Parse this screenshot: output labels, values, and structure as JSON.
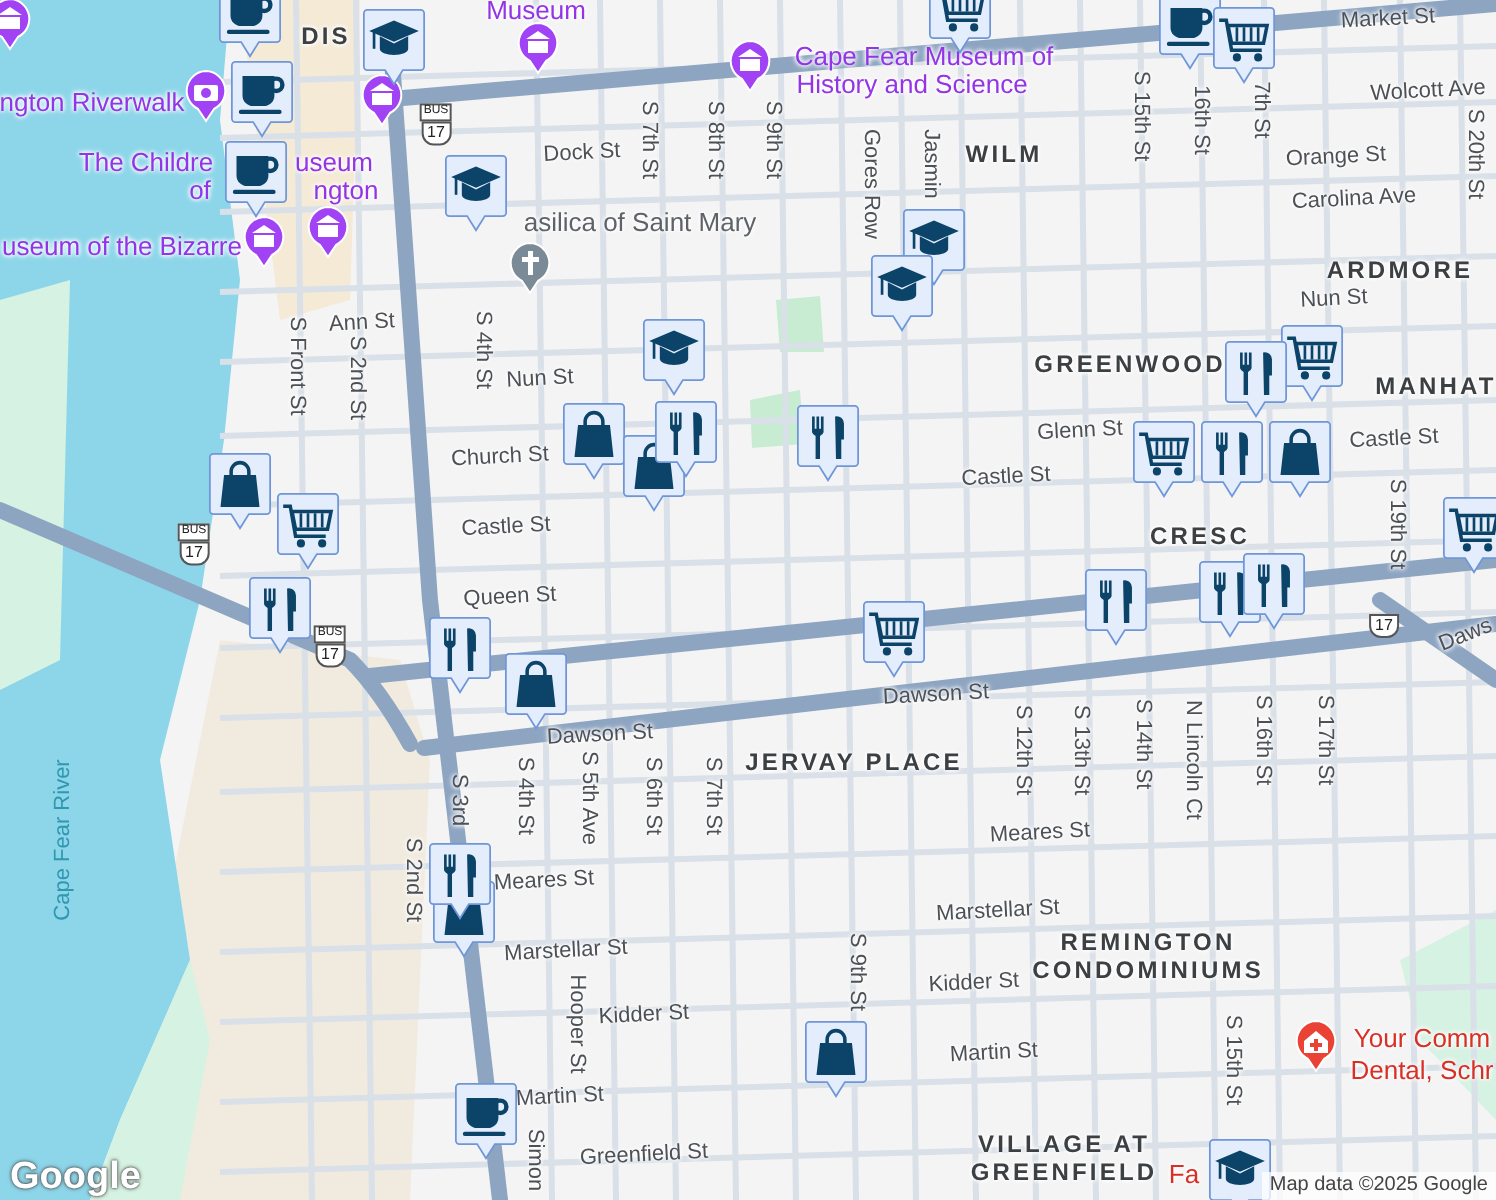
{
  "map": {
    "labels": [
      {
        "kind": "street",
        "text": "Dock St"
      },
      {
        "kind": "street",
        "text": "Ann St"
      },
      {
        "kind": "street",
        "text": "Nun St"
      },
      {
        "kind": "street",
        "text": "Church St"
      },
      {
        "kind": "street",
        "text": "Castle St"
      },
      {
        "kind": "street",
        "text": "Queen St"
      },
      {
        "kind": "street",
        "text": "Dawson St"
      },
      {
        "kind": "street",
        "text": "Dawson St"
      },
      {
        "kind": "street",
        "text": "Meares St"
      },
      {
        "kind": "street",
        "text": "Meares St"
      },
      {
        "kind": "street",
        "text": "Marstellar St"
      },
      {
        "kind": "street",
        "text": "Marstellar St"
      },
      {
        "kind": "street",
        "text": "Kidder St"
      },
      {
        "kind": "street",
        "text": "Kidder St"
      },
      {
        "kind": "street",
        "text": "Martin St"
      },
      {
        "kind": "street",
        "text": "Martin St"
      },
      {
        "kind": "street",
        "text": "Greenfield St"
      },
      {
        "kind": "street",
        "text": "Orange St"
      },
      {
        "kind": "street",
        "text": "Carolina Ave"
      },
      {
        "kind": "street",
        "text": "Wolcott Ave"
      },
      {
        "kind": "street",
        "text": "Nun St"
      },
      {
        "kind": "street",
        "text": "Glenn St"
      },
      {
        "kind": "street",
        "text": "Castle St"
      },
      {
        "kind": "street",
        "text": "Castle St"
      },
      {
        "kind": "street",
        "text": "Market St"
      },
      {
        "kind": "street",
        "text": "Daws"
      },
      {
        "kind": "street",
        "text": "S Front St"
      },
      {
        "kind": "street",
        "text": "S 2nd St"
      },
      {
        "kind": "street",
        "text": "S 4th St"
      },
      {
        "kind": "street",
        "text": "S 7th St"
      },
      {
        "kind": "street",
        "text": "S 8th St"
      },
      {
        "kind": "street",
        "text": "S 9th St"
      },
      {
        "kind": "street",
        "text": "Gores Row"
      },
      {
        "kind": "street",
        "text": "Jasmin"
      },
      {
        "kind": "street",
        "text": "S 15th St"
      },
      {
        "kind": "street",
        "text": "16th St"
      },
      {
        "kind": "street",
        "text": "7th St"
      },
      {
        "kind": "street",
        "text": "S 20th St"
      },
      {
        "kind": "street",
        "text": "S 3rd"
      },
      {
        "kind": "street",
        "text": "S 4th St"
      },
      {
        "kind": "street",
        "text": "S 5th Ave"
      },
      {
        "kind": "street",
        "text": "S 6th St"
      },
      {
        "kind": "street",
        "text": "S 7th St"
      },
      {
        "kind": "street",
        "text": "S 2nd St"
      },
      {
        "kind": "street",
        "text": "Hooper St"
      },
      {
        "kind": "street",
        "text": "Simon"
      },
      {
        "kind": "street",
        "text": "S 12th St"
      },
      {
        "kind": "street",
        "text": "S 13th St"
      },
      {
        "kind": "street",
        "text": "S 14th St"
      },
      {
        "kind": "street",
        "text": "N Lincoln Ct"
      },
      {
        "kind": "street",
        "text": "S 16th St"
      },
      {
        "kind": "street",
        "text": "S 17th St"
      },
      {
        "kind": "street",
        "text": "S 9th St"
      },
      {
        "kind": "street",
        "text": "S 15th St"
      },
      {
        "kind": "street",
        "text": "S 19th St"
      },
      {
        "kind": "area",
        "text": "DIS"
      },
      {
        "kind": "area",
        "text": "WILM"
      },
      {
        "kind": "area",
        "text": "ARDMORE"
      },
      {
        "kind": "area",
        "text": "GREENWOOD"
      },
      {
        "kind": "area",
        "text": "MANHAT"
      },
      {
        "kind": "area",
        "text": "CRESC"
      },
      {
        "kind": "area",
        "text": "JERVAY PLACE"
      },
      {
        "kind": "area",
        "text": "REMINGTON"
      },
      {
        "kind": "area",
        "text": "CONDOMINIUMS"
      },
      {
        "kind": "area",
        "text": "VILLAGE AT"
      },
      {
        "kind": "area",
        "text": "GREENFIELD"
      },
      {
        "kind": "attraction",
        "text": "Museum"
      },
      {
        "kind": "attraction",
        "text": "Cape Fear Museum of"
      },
      {
        "kind": "attraction",
        "text": "History and Science"
      },
      {
        "kind": "attraction",
        "text": "ngton Riverwalk"
      },
      {
        "kind": "attraction",
        "text": "The Childre"
      },
      {
        "kind": "attraction",
        "text": "useum"
      },
      {
        "kind": "attraction",
        "text": "of"
      },
      {
        "kind": "attraction",
        "text": "ngton"
      },
      {
        "kind": "attraction",
        "text": "useum of the Bizarre"
      },
      {
        "kind": "worship",
        "text": "asilica of Saint Mary"
      },
      {
        "kind": "water",
        "text": "Cape Fear River"
      },
      {
        "kind": "health",
        "text": "Your Comm"
      },
      {
        "kind": "health",
        "text": "Dental, Schr"
      },
      {
        "kind": "health",
        "text": "Fa"
      }
    ],
    "shields": [
      {
        "top": "BUS",
        "number": "17"
      },
      {
        "top": "BUS",
        "number": "17"
      },
      {
        "top": "BUS",
        "number": "17"
      },
      {
        "number": "17"
      }
    ],
    "places": [
      {
        "kind": "museum"
      },
      {
        "kind": "museum"
      },
      {
        "kind": "museum"
      },
      {
        "kind": "museum"
      },
      {
        "kind": "museum"
      },
      {
        "kind": "museum"
      },
      {
        "kind": "camera"
      },
      {
        "kind": "church"
      },
      {
        "kind": "dental"
      }
    ],
    "pins": [
      {
        "kind": "cup"
      },
      {
        "kind": "cup"
      },
      {
        "kind": "cup"
      },
      {
        "kind": "cup"
      },
      {
        "kind": "cup"
      },
      {
        "kind": "school"
      },
      {
        "kind": "school"
      },
      {
        "kind": "school"
      },
      {
        "kind": "school"
      },
      {
        "kind": "school"
      },
      {
        "kind": "school"
      },
      {
        "kind": "bag"
      },
      {
        "kind": "bag"
      },
      {
        "kind": "bag"
      },
      {
        "kind": "bag"
      },
      {
        "kind": "bag"
      },
      {
        "kind": "bag"
      },
      {
        "kind": "bag"
      },
      {
        "kind": "cart"
      },
      {
        "kind": "cart"
      },
      {
        "kind": "cart"
      },
      {
        "kind": "cart"
      },
      {
        "kind": "cart"
      },
      {
        "kind": "cart"
      },
      {
        "kind": "cart"
      },
      {
        "kind": "food"
      },
      {
        "kind": "food"
      },
      {
        "kind": "food"
      },
      {
        "kind": "food"
      },
      {
        "kind": "food"
      },
      {
        "kind": "food"
      },
      {
        "kind": "food"
      },
      {
        "kind": "food"
      },
      {
        "kind": "food"
      },
      {
        "kind": "food"
      }
    ],
    "logo": "Google",
    "attribution": "Map data ©2025 Google"
  }
}
